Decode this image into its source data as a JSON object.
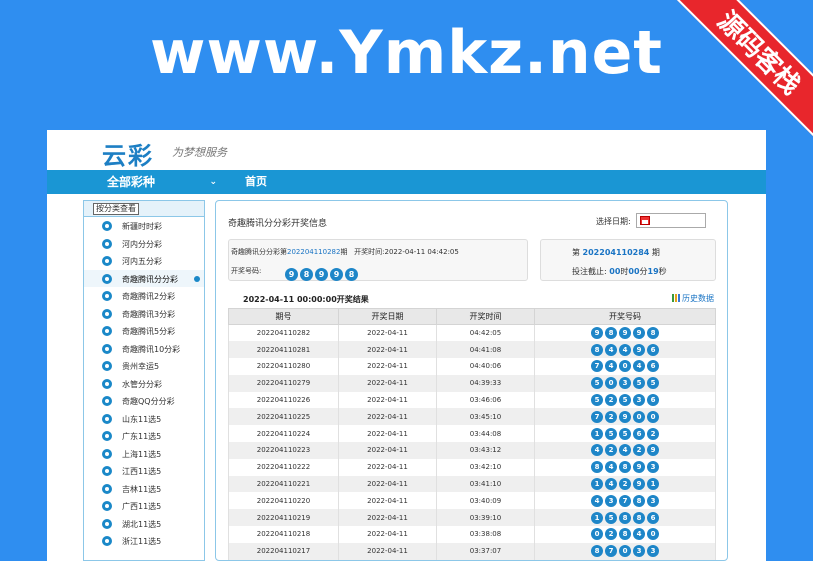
{
  "banner": {
    "title": "www.Ymkz.net",
    "ribbon": "源码客栈"
  },
  "header": {
    "logo": "云彩",
    "slogan": "为梦想服务"
  },
  "nav": {
    "all_label": "全部彩种",
    "caret": "⌄",
    "home": "首页"
  },
  "sidebar": {
    "heading": "按分类查看",
    "items": [
      {
        "label": "新疆时时彩"
      },
      {
        "label": "河内分分彩"
      },
      {
        "label": "河内五分彩"
      },
      {
        "label": "奇趣腾讯分分彩",
        "active": true
      },
      {
        "label": "奇趣腾讯2分彩"
      },
      {
        "label": "奇趣腾讯3分彩"
      },
      {
        "label": "奇趣腾讯5分彩"
      },
      {
        "label": "奇趣腾讯10分彩"
      },
      {
        "label": "贵州幸运5"
      },
      {
        "label": "水管分分彩"
      },
      {
        "label": "奇趣QQ分分彩"
      },
      {
        "label": "山东11选5"
      },
      {
        "label": "广东11选5"
      },
      {
        "label": "上海11选5"
      },
      {
        "label": "江西11选5"
      },
      {
        "label": "吉林11选5"
      },
      {
        "label": "广西11选5"
      },
      {
        "label": "湖北11选5"
      },
      {
        "label": "浙江11选5"
      }
    ]
  },
  "main": {
    "title": "奇趣腾讯分分彩开奖信息",
    "date_label": "选择日期:",
    "current": {
      "prefix": "奇趣腾讯分分彩第",
      "issue": "202204110282",
      "suffix": "期",
      "time_label": "开奖时间:",
      "time": "2022-04-11 04:42:05",
      "numbers_label": "开奖号码:",
      "numbers": [
        "9",
        "8",
        "9",
        "9",
        "8"
      ]
    },
    "next": {
      "prefix": "第",
      "issue": "202204110284",
      "suffix": "期",
      "deadline_label": "投注截止:",
      "hours": "00",
      "hours_unit": "时",
      "minutes": "00",
      "minutes_unit": "分",
      "seconds": "19",
      "seconds_unit": "秒"
    },
    "results": {
      "title": "2022-04-11 00:00:00开奖结果",
      "history_link": "历史数据",
      "columns": [
        "期号",
        "开奖日期",
        "开奖时间",
        "开奖号码"
      ],
      "rows": [
        {
          "issue": "202204110282",
          "date": "2022-04-11",
          "time": "04:42:05",
          "nums": [
            "9",
            "8",
            "9",
            "9",
            "8"
          ]
        },
        {
          "issue": "202204110281",
          "date": "2022-04-11",
          "time": "04:41:08",
          "nums": [
            "8",
            "4",
            "4",
            "9",
            "6"
          ]
        },
        {
          "issue": "202204110280",
          "date": "2022-04-11",
          "time": "04:40:06",
          "nums": [
            "7",
            "4",
            "0",
            "4",
            "6"
          ]
        },
        {
          "issue": "202204110279",
          "date": "2022-04-11",
          "time": "04:39:33",
          "nums": [
            "5",
            "0",
            "3",
            "5",
            "5"
          ]
        },
        {
          "issue": "202204110226",
          "date": "2022-04-11",
          "time": "03:46:06",
          "nums": [
            "5",
            "2",
            "5",
            "3",
            "6"
          ]
        },
        {
          "issue": "202204110225",
          "date": "2022-04-11",
          "time": "03:45:10",
          "nums": [
            "7",
            "2",
            "9",
            "0",
            "0"
          ]
        },
        {
          "issue": "202204110224",
          "date": "2022-04-11",
          "time": "03:44:08",
          "nums": [
            "1",
            "5",
            "5",
            "6",
            "2"
          ]
        },
        {
          "issue": "202204110223",
          "date": "2022-04-11",
          "time": "03:43:12",
          "nums": [
            "4",
            "2",
            "4",
            "2",
            "9"
          ]
        },
        {
          "issue": "202204110222",
          "date": "2022-04-11",
          "time": "03:42:10",
          "nums": [
            "8",
            "4",
            "8",
            "9",
            "3"
          ]
        },
        {
          "issue": "202204110221",
          "date": "2022-04-11",
          "time": "03:41:10",
          "nums": [
            "1",
            "4",
            "2",
            "9",
            "1"
          ]
        },
        {
          "issue": "202204110220",
          "date": "2022-04-11",
          "time": "03:40:09",
          "nums": [
            "4",
            "3",
            "7",
            "8",
            "3"
          ]
        },
        {
          "issue": "202204110219",
          "date": "2022-04-11",
          "time": "03:39:10",
          "nums": [
            "1",
            "5",
            "8",
            "8",
            "6"
          ]
        },
        {
          "issue": "202204110218",
          "date": "2022-04-11",
          "time": "03:38:08",
          "nums": [
            "0",
            "2",
            "8",
            "4",
            "0"
          ]
        },
        {
          "issue": "202204110217",
          "date": "2022-04-11",
          "time": "03:37:07",
          "nums": [
            "8",
            "7",
            "0",
            "3",
            "3"
          ]
        }
      ]
    }
  },
  "colors": {
    "background": "#2f8ef0",
    "nav": "#1a96d4",
    "ball": "#1e86c8",
    "ribbon": "#e8262c"
  }
}
